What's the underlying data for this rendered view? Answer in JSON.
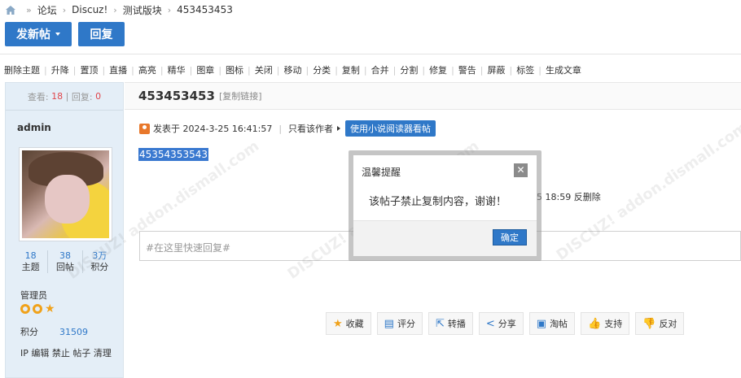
{
  "breadcrumb": {
    "items": [
      "论坛",
      "Discuz!",
      "测试版块",
      "453453453"
    ]
  },
  "buttons": {
    "new_post": "发新帖",
    "reply": "回复"
  },
  "mod_toolbar": [
    "删除主题",
    "升降",
    "置顶",
    "直播",
    "高亮",
    "精华",
    "图章",
    "图标",
    "关闭",
    "移动",
    "分类",
    "复制",
    "合并",
    "分割",
    "修复",
    "警告",
    "屏蔽",
    "标签",
    "生成文章"
  ],
  "stats": {
    "views_label": "查看:",
    "views": "18",
    "sep": "|",
    "replies_label": "回复:",
    "replies": "0"
  },
  "author": {
    "name": "admin",
    "counts": [
      {
        "num": "18",
        "label": "主题"
      },
      {
        "num": "38",
        "label": "回帖"
      },
      {
        "num": "3万",
        "label": "积分"
      }
    ],
    "role": "管理员",
    "points_label": "积分",
    "points": "31509",
    "admin_ops": "IP 编辑 禁止 帖子 清理"
  },
  "post": {
    "title": "453453453",
    "copy_link": "[复制链接]",
    "posted_at": "发表于 2024-3-25 16:41:57",
    "only_author": "只看该作者",
    "novel_reader": "使用小说阅读器看帖",
    "content": "45354353543",
    "deleted_note": "5 18:59 反删除"
  },
  "quick_reply": {
    "placeholder": "#在这里快速回复#"
  },
  "actions": [
    {
      "icon": "star-icon",
      "label": "收藏"
    },
    {
      "icon": "rate-icon",
      "label": "评分"
    },
    {
      "icon": "share-external-icon",
      "label": "转播"
    },
    {
      "icon": "share-icon",
      "label": "分享"
    },
    {
      "icon": "taotie-icon",
      "label": "淘帖"
    },
    {
      "icon": "thumbs-up-icon",
      "label": "支持"
    },
    {
      "icon": "thumbs-down-icon",
      "label": "反对"
    }
  ],
  "dialog": {
    "title": "温馨提醒",
    "message": "该帖子禁止复制内容，谢谢！",
    "ok": "确定"
  },
  "colors": {
    "primary": "#2f78c8",
    "accent_red": "#e0454b",
    "star": "#f0a21b"
  }
}
